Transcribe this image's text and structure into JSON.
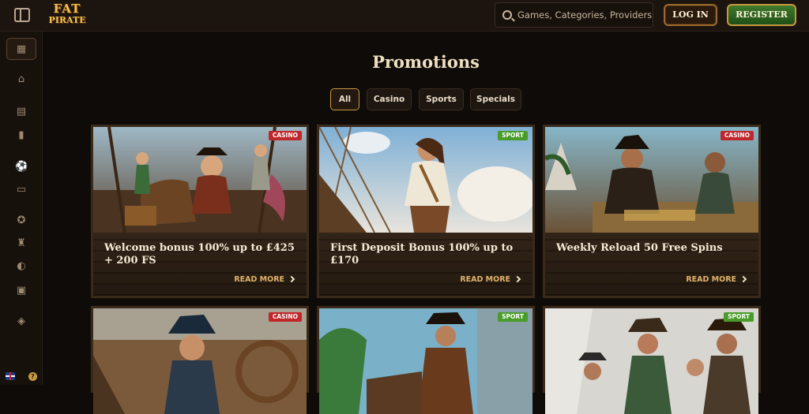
{
  "header": {
    "logo_line1": "FAT",
    "logo_line2": "PIRATE",
    "search_placeholder": "Games, Categories, Providers",
    "login_label": "LOG IN",
    "register_label": "REGISTER"
  },
  "sidebar": {
    "icons": [
      "promotions-icon",
      "home-icon",
      "calendar-icon",
      "cards-icon",
      "football-icon",
      "live-icon",
      "badge-icon",
      "trophy-icon",
      "palette-icon",
      "basket-icon",
      "diamond-icon"
    ],
    "language": "English",
    "help": "?"
  },
  "page": {
    "title": "Promotions",
    "filters": [
      "All",
      "Casino",
      "Sports",
      "Specials"
    ],
    "active_filter": "All"
  },
  "cards": [
    {
      "badge": "CASINO",
      "title": "Welcome bonus 100% up to £425 + 200 FS",
      "cta": "READ MORE"
    },
    {
      "badge": "SPORT",
      "title": "First Deposit Bonus 100% up to £170",
      "cta": "READ MORE"
    },
    {
      "badge": "CASINO",
      "title": "Weekly Reload 50 Free Spins",
      "cta": "READ MORE"
    },
    {
      "badge": "CASINO",
      "title": "",
      "cta": ""
    },
    {
      "badge": "SPORT",
      "title": "",
      "cta": ""
    },
    {
      "badge": "SPORT",
      "title": "",
      "cta": ""
    }
  ],
  "colors": {
    "background": "#0f0b08",
    "accent_gold": "#c89a3f",
    "casino_badge": "#c0262a",
    "sport_badge": "#4a9c2a"
  }
}
